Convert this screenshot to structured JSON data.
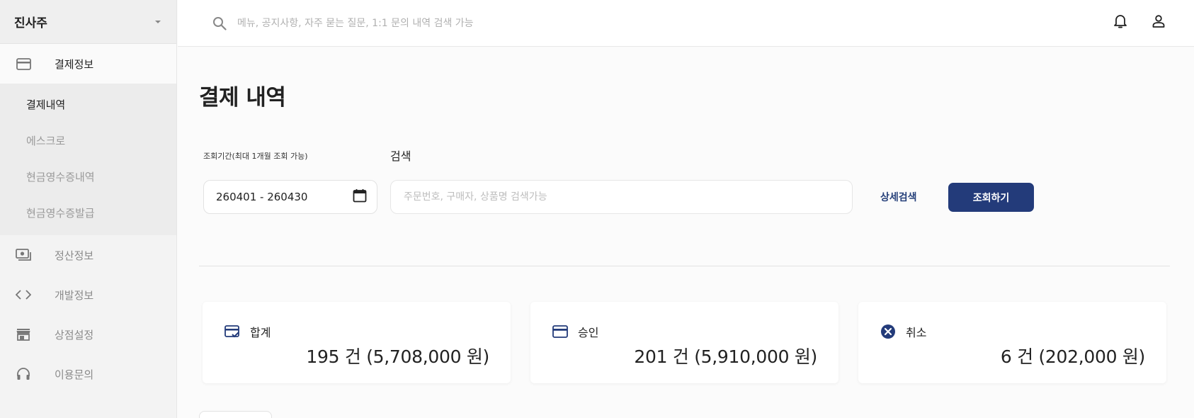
{
  "sidebar": {
    "store_name": "진사주",
    "menu": [
      {
        "label": "결제정보",
        "icon": "credit-card-icon"
      },
      {
        "label": "정산정보",
        "icon": "cash-icon"
      },
      {
        "label": "개발정보",
        "icon": "code-icon"
      },
      {
        "label": "상점설정",
        "icon": "store-icon"
      },
      {
        "label": "이용문의",
        "icon": "headset-icon"
      }
    ],
    "submenu": [
      {
        "label": "결제내역",
        "active": true
      },
      {
        "label": "에스크로"
      },
      {
        "label": "현금영수증내역"
      },
      {
        "label": "현금영수증발급"
      }
    ]
  },
  "header": {
    "search_placeholder": "메뉴, 공지사항, 자주 묻는 질문, 1:1 문의 내역 검색 가능"
  },
  "page": {
    "title": "결제 내역",
    "filters": {
      "period_label": "조회기간(최대 1개월 조회 가능)",
      "period_value": "260401 - 260430",
      "search_label": "검색",
      "search_placeholder": "주문번호, 구매자, 상품명 검색가능",
      "detail_search": "상세검색",
      "query_button": "조회하기"
    },
    "summary": [
      {
        "label": "합계",
        "value": "195 건 (5,708,000 원)",
        "icon": "card-check-icon"
      },
      {
        "label": "승인",
        "value": "201 건 (5,910,000 원)",
        "icon": "credit-card-icon"
      },
      {
        "label": "취소",
        "value": "6 건 (202,000 원)",
        "icon": "cancel-circle-icon"
      }
    ]
  },
  "colors": {
    "primary": "#233b7a",
    "sidebar_bg": "#f3f3f3",
    "page_bg": "#fbfbfb"
  }
}
